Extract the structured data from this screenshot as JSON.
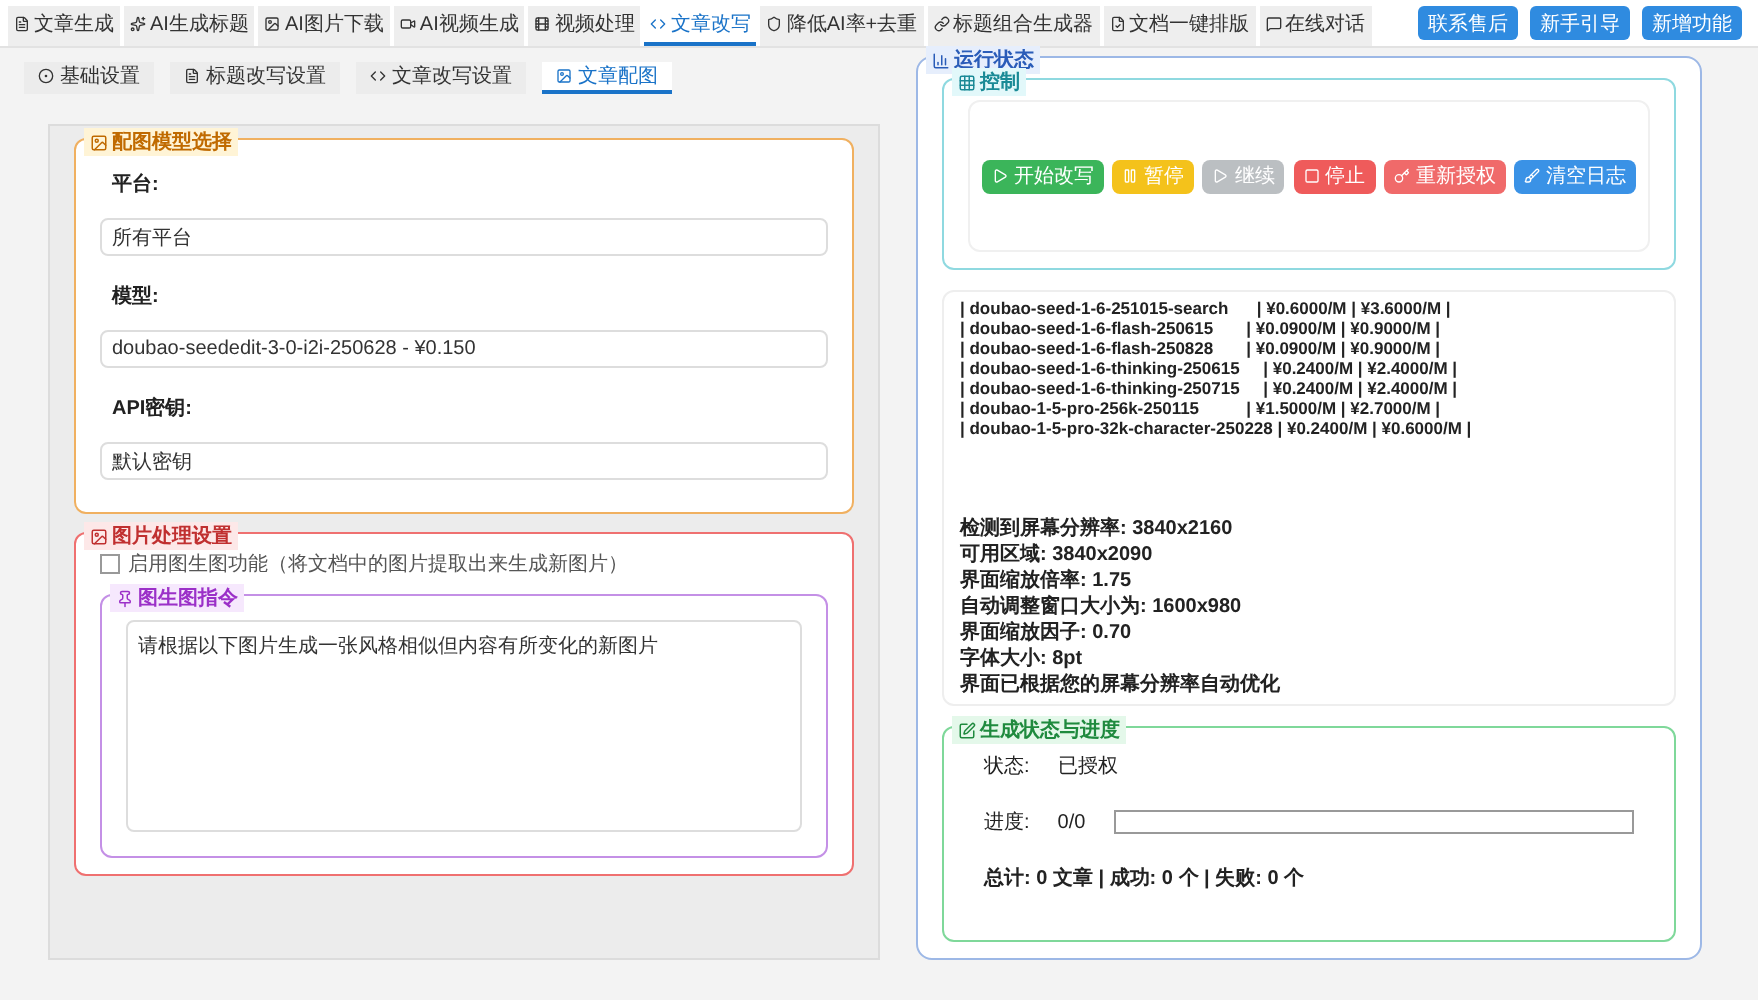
{
  "top_tabs": [
    {
      "label": "文章生成",
      "selected": false
    },
    {
      "label": "AI生成标题",
      "selected": false
    },
    {
      "label": "AI图片下载",
      "selected": false
    },
    {
      "label": "AI视频生成",
      "selected": false
    },
    {
      "label": "视频处理",
      "selected": false
    },
    {
      "label": "文章改写",
      "selected": true
    },
    {
      "label": "降低AI率+去重",
      "selected": false
    },
    {
      "label": "标题组合生成器",
      "selected": false
    },
    {
      "label": "文档一键排版",
      "selected": false
    },
    {
      "label": "在线对话",
      "selected": false
    }
  ],
  "header_buttons": [
    "联系售后",
    "新手引导",
    "新增功能"
  ],
  "sub_tabs": [
    {
      "label": "基础设置",
      "selected": false
    },
    {
      "label": "标题改写设置",
      "selected": false
    },
    {
      "label": "文章改写设置",
      "selected": false
    },
    {
      "label": "文章配图",
      "selected": true
    }
  ],
  "model_section": {
    "title": "配图模型选择",
    "fields": [
      {
        "label": "平台:",
        "value": "所有平台"
      },
      {
        "label": "模型:",
        "value": "doubao-seededit-3-0-i2i-250628 - ¥0.150"
      },
      {
        "label": "API密钥:",
        "value": "默认密钥"
      }
    ]
  },
  "image_section": {
    "title": "图片处理设置",
    "checkbox": {
      "label": "启用图生图功能（将文档中的图片提取出来生成新图片）",
      "checked": false
    },
    "prompt": {
      "title": "图生图指令",
      "value": "请根据以下图片生成一张风格相似但内容有所变化的新图片"
    }
  },
  "status_panel": {
    "title": "运行状态",
    "control": {
      "title": "控制",
      "buttons": [
        {
          "label": "开始改写",
          "kind": "start",
          "disabled": false
        },
        {
          "label": "暂停",
          "kind": "pause",
          "disabled": false
        },
        {
          "label": "继续",
          "kind": "resume",
          "disabled": true
        },
        {
          "label": "停止",
          "kind": "stop",
          "disabled": false
        },
        {
          "label": "重新授权",
          "kind": "auth",
          "disabled": false
        },
        {
          "label": "清空日志",
          "kind": "clear",
          "disabled": false
        }
      ]
    },
    "log": {
      "lines": [
        "| doubao-seed-1-6-251015-search      | ¥0.6000/M | ¥3.6000/M |",
        "| doubao-seed-1-6-flash-250615       | ¥0.0900/M | ¥0.9000/M |",
        "| doubao-seed-1-6-flash-250828       | ¥0.0900/M | ¥0.9000/M |",
        "| doubao-seed-1-6-thinking-250615     | ¥0.2400/M | ¥2.4000/M |",
        "| doubao-seed-1-6-thinking-250715     | ¥0.2400/M | ¥2.4000/M |",
        "| doubao-1-5-pro-256k-250115          | ¥1.5000/M | ¥2.7000/M |",
        "| doubao-1-5-pro-32k-character-250228 | ¥0.2400/M | ¥0.6000/M |"
      ],
      "lines_after": [
        "检测到屏幕分辨率: 3840x2160",
        "可用区域: 3840x2090",
        "界面缩放倍率: 1.75",
        "自动调整窗口大小为: 1600x980",
        "界面缩放因子: 0.70",
        "字体大小: 8pt",
        "界面已根据您的屏幕分辨率自动优化"
      ]
    },
    "progress": {
      "title": "生成状态与进度",
      "status_label": "状态:",
      "status_value": "已授权",
      "progress_label": "进度:",
      "progress_value": "0/0",
      "level": 0,
      "summary": "总计: 0 文章 | 成功: 0 个 | 失败: 0 个"
    }
  }
}
